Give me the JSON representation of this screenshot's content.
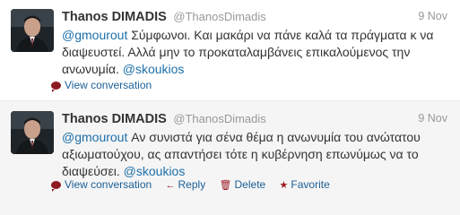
{
  "tweets": [
    {
      "fullname": "Thanos DIMADIS",
      "username": "@ThanosDimadis",
      "timestamp": "9 Nov",
      "mention_start": "@gmourout",
      "text_main": " Σύμφωνοι. Και μακάρι να πάνε καλά τα πράγματα κ να διαψευστεί. Αλλά μην το προκαταλαμβάνεις επικαλούμενος την ανωνυμία. ",
      "mention_end": "@skoukios",
      "actions": {
        "view_conversation": "View conversation"
      }
    },
    {
      "fullname": "Thanos DIMADIS",
      "username": "@ThanosDimadis",
      "timestamp": "9 Nov",
      "mention_start": "@gmourout",
      "text_main": " Αν συνιστά για σένα θέμα η ανωνυμία του ανώτατου αξιωματούχου, ας απαντήσει τότε η κυβέρνηση επωνύμως να το διαψεύσει. ",
      "mention_end": "@skoukios",
      "actions": {
        "view_conversation": "View conversation",
        "reply": "Reply",
        "delete": "Delete",
        "favorite": "Favorite"
      }
    }
  ],
  "colors": {
    "link": "#1a5f97",
    "mention": "#1c6fa9",
    "icon": "#9b1b24",
    "name": "#333333",
    "meta": "#999999"
  },
  "icons": [
    "avatar",
    "conversation-bubble-icon",
    "reply-arrow-icon",
    "trash-icon",
    "star-icon"
  ]
}
